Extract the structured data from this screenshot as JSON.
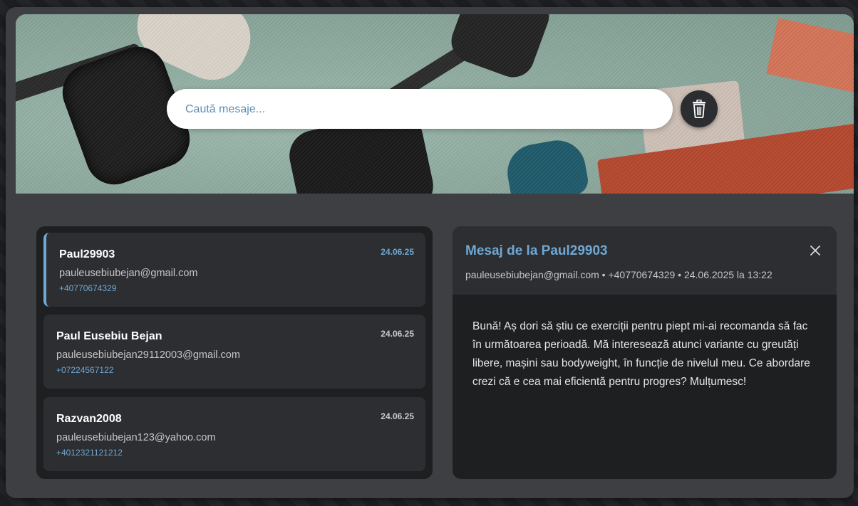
{
  "search": {
    "placeholder": "Caută mesaje..."
  },
  "icons": {
    "trash": "trash-icon",
    "close": "close-icon"
  },
  "colors": {
    "accent": "#6fa8d4",
    "panel_bg": "#1d1f21",
    "card_bg": "#2c2e31",
    "app_bg": "#3d3f42"
  },
  "messages": [
    {
      "name": "Paul29903",
      "email": "pauleusebiubejan@gmail.com",
      "phone": "+40770674329",
      "date": "24.06.25",
      "active": true
    },
    {
      "name": "Paul Eusebiu Bejan",
      "email": "pauleusebiubejan29112003@gmail.com",
      "phone": "+07224567122",
      "date": "24.06.25",
      "active": false
    },
    {
      "name": "Razvan2008",
      "email": "pauleusebiubejan123@yahoo.com",
      "phone": "+4012321121212",
      "date": "24.06.25",
      "active": false
    }
  ],
  "detail": {
    "title": "Mesaj de la Paul29903",
    "meta": "pauleusebiubejan@gmail.com • +40770674329 • 24.06.2025 la 13:22",
    "body": "Bună! Aș dori să știu ce exerciții pentru piept mi-ai recomanda să fac în următoarea perioadă. Mă interesează atunci variante cu greutăți libere, mașini sau bodyweight, în funcție de nivelul meu. Ce abordare crezi că e cea mai eficientă pentru progres? Mulțumesc!"
  }
}
